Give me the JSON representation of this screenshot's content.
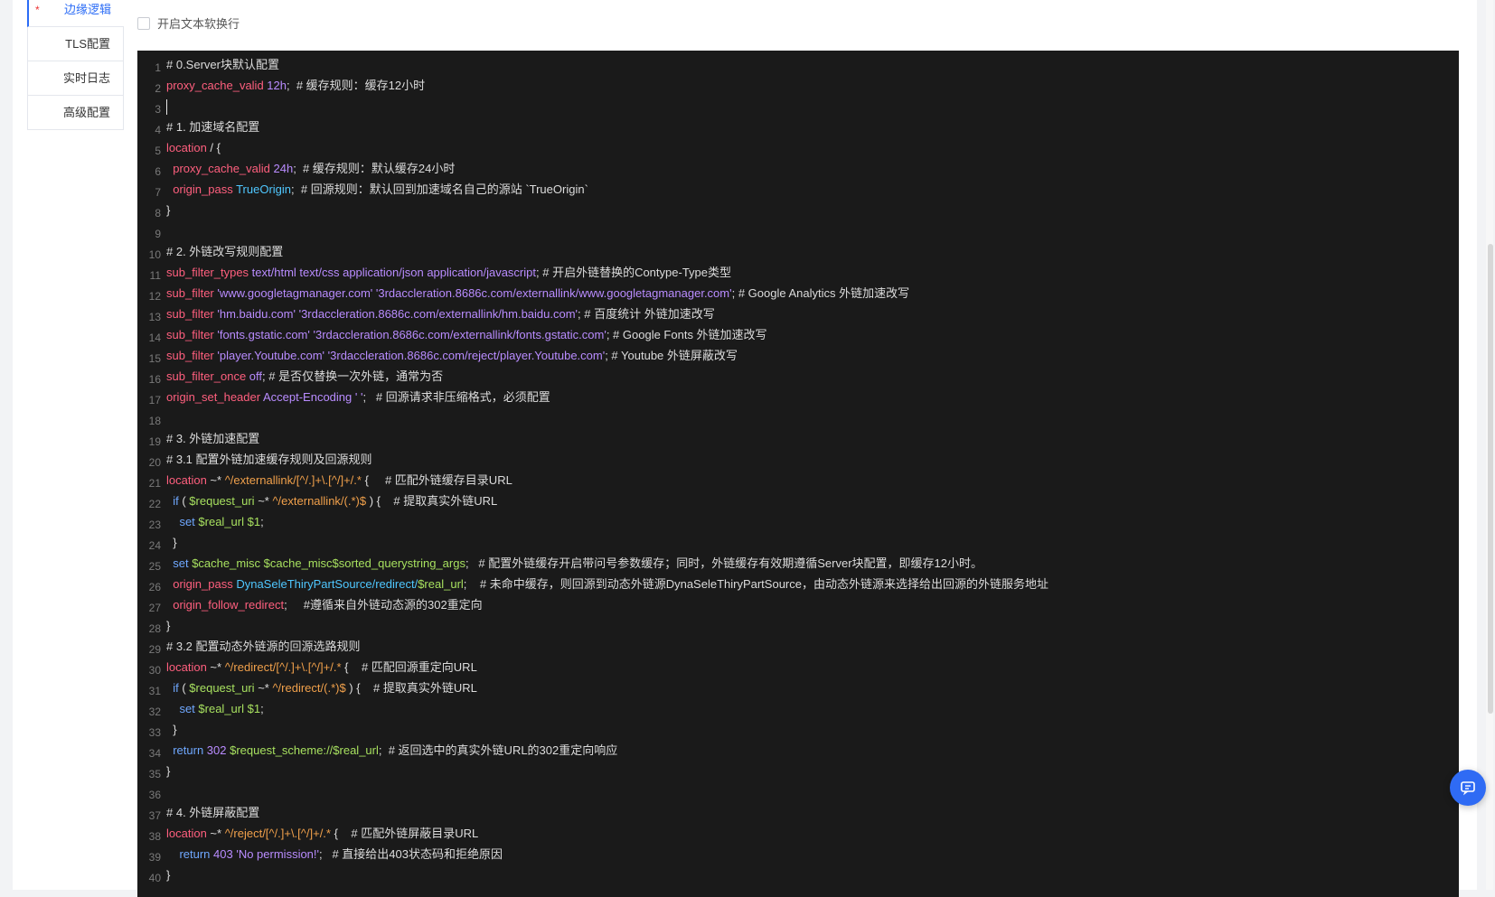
{
  "tabs": [
    {
      "label": "边缘逻辑",
      "required_mark": "*"
    },
    {
      "label": "TLS配置"
    },
    {
      "label": "实时日志"
    },
    {
      "label": "高级配置"
    }
  ],
  "soft_wrap": {
    "label": "开启文本软换行",
    "checked": false
  },
  "code_lines": [
    {
      "n": "1",
      "segs": [
        {
          "c": "c",
          "t": "# 0.Server块默认配置"
        }
      ]
    },
    {
      "n": "2",
      "segs": [
        {
          "c": "k",
          "t": "proxy_cache_valid"
        },
        {
          "c": "n",
          "t": " 12h"
        },
        {
          "c": "c",
          "t": ";  # 缓存规则：缓存12小时"
        }
      ]
    },
    {
      "n": "3",
      "segs": [],
      "caret": true
    },
    {
      "n": "4",
      "segs": [
        {
          "c": "c",
          "t": "# 1. 加速域名配置"
        }
      ]
    },
    {
      "n": "5",
      "segs": [
        {
          "c": "k",
          "t": "location"
        },
        {
          "c": "c",
          "t": " / {"
        }
      ]
    },
    {
      "n": "6",
      "segs": [
        {
          "c": "k",
          "t": "  proxy_cache_valid"
        },
        {
          "c": "n",
          "t": " 24h"
        },
        {
          "c": "c",
          "t": ";  # 缓存规则：默认缓存24小时"
        }
      ]
    },
    {
      "n": "7",
      "segs": [
        {
          "c": "k",
          "t": "  origin_pass"
        },
        {
          "c": "t",
          "t": " TrueOrigin"
        },
        {
          "c": "c",
          "t": ";  # 回源规则：默认回到加速域名自己的源站 `TrueOrigin`"
        }
      ]
    },
    {
      "n": "8",
      "segs": [
        {
          "c": "c",
          "t": "}"
        }
      ]
    },
    {
      "n": "9",
      "segs": []
    },
    {
      "n": "10",
      "segs": [
        {
          "c": "c",
          "t": "# 2. 外链改写规则配置"
        }
      ]
    },
    {
      "n": "11",
      "segs": [
        {
          "c": "k",
          "t": "sub_filter_types"
        },
        {
          "c": "v",
          "t": " text/html text/css application/json application/javascript"
        },
        {
          "c": "c",
          "t": "; # 开启外链替换的Contype-Type类型"
        }
      ]
    },
    {
      "n": "12",
      "segs": [
        {
          "c": "k",
          "t": "sub_filter"
        },
        {
          "c": "v",
          "t": " 'www.googletagmanager.com' '3rdaccleration.8686c.com/externallink/www.googletagmanager.com'"
        },
        {
          "c": "c",
          "t": "; # Google Analytics 外链加速改写"
        }
      ]
    },
    {
      "n": "13",
      "segs": [
        {
          "c": "k",
          "t": "sub_filter"
        },
        {
          "c": "v",
          "t": " 'hm.baidu.com' '3rdaccleration.8686c.com/externallink/hm.baidu.com'"
        },
        {
          "c": "c",
          "t": "; # 百度统计 外链加速改写"
        }
      ]
    },
    {
      "n": "14",
      "segs": [
        {
          "c": "k",
          "t": "sub_filter"
        },
        {
          "c": "v",
          "t": " 'fonts.gstatic.com' '3rdaccleration.8686c.com/externallink/fonts.gstatic.com'"
        },
        {
          "c": "c",
          "t": "; # Google Fonts 外链加速改写"
        }
      ]
    },
    {
      "n": "15",
      "segs": [
        {
          "c": "k",
          "t": "sub_filter"
        },
        {
          "c": "v",
          "t": " 'player.Youtube.com' '3rdaccleration.8686c.com/reject/player.Youtube.com'"
        },
        {
          "c": "c",
          "t": "; # Youtube 外链屏蔽改写"
        }
      ]
    },
    {
      "n": "16",
      "segs": [
        {
          "c": "k",
          "t": "sub_filter_once"
        },
        {
          "c": "v",
          "t": " off"
        },
        {
          "c": "c",
          "t": "; # 是否仅替换一次外链，通常为否"
        }
      ]
    },
    {
      "n": "17",
      "segs": [
        {
          "c": "k",
          "t": "origin_set_header"
        },
        {
          "c": "v",
          "t": " Accept-Encoding ' '"
        },
        {
          "c": "c",
          "t": ";   # 回源请求非压缩格式，必须配置"
        }
      ]
    },
    {
      "n": "18",
      "segs": []
    },
    {
      "n": "19",
      "segs": [
        {
          "c": "c",
          "t": "# 3. 外链加速配置"
        }
      ]
    },
    {
      "n": "20",
      "segs": [
        {
          "c": "c",
          "t": "# 3.1 配置外链加速缓存规则及回源规则"
        }
      ]
    },
    {
      "n": "21",
      "segs": [
        {
          "c": "k",
          "t": "location"
        },
        {
          "c": "c",
          "t": " ~* "
        },
        {
          "c": "s",
          "t": "^/externallink/[^/.]+\\.[^/]+/.*"
        },
        {
          "c": "c",
          "t": " {     # 匹配外链缓存目录URL"
        }
      ]
    },
    {
      "n": "22",
      "segs": [
        {
          "c": "kb",
          "t": "  if"
        },
        {
          "c": "c",
          "t": " ( "
        },
        {
          "c": "var",
          "t": "$request_uri"
        },
        {
          "c": "c",
          "t": " ~* "
        },
        {
          "c": "s",
          "t": "^/externallink/(.*)$"
        },
        {
          "c": "c",
          "t": " ) {    # 提取真实外链URL"
        }
      ]
    },
    {
      "n": "23",
      "segs": [
        {
          "c": "kb",
          "t": "    set"
        },
        {
          "c": "var",
          "t": " $real_url $1"
        },
        {
          "c": "c",
          "t": ";"
        }
      ]
    },
    {
      "n": "24",
      "segs": [
        {
          "c": "c",
          "t": "  }"
        }
      ]
    },
    {
      "n": "25",
      "segs": [
        {
          "c": "kb",
          "t": "  set"
        },
        {
          "c": "var",
          "t": " $cache_misc $cache_misc$sorted_querystring_args"
        },
        {
          "c": "c",
          "t": ";   # 配置外链缓存开启带问号参数缓存；同时，外链缓存有效期遵循Server块配置，即缓存12小时。"
        }
      ]
    },
    {
      "n": "26",
      "segs": [
        {
          "c": "k",
          "t": "  origin_pass"
        },
        {
          "c": "t",
          "t": " DynaSeleThiryPartSource/redirect/"
        },
        {
          "c": "var",
          "t": "$real_url"
        },
        {
          "c": "c",
          "t": ";    # 未命中缓存，则回源到动态外链源DynaSeleThiryPartSource，由动态外链源来选择给出回源的外链服务地址"
        }
      ]
    },
    {
      "n": "27",
      "segs": [
        {
          "c": "k",
          "t": "  origin_follow_redirect"
        },
        {
          "c": "c",
          "t": ";     #遵循来自外链动态源的302重定向"
        }
      ]
    },
    {
      "n": "28",
      "segs": [
        {
          "c": "c",
          "t": "}"
        }
      ]
    },
    {
      "n": "29",
      "segs": [
        {
          "c": "c",
          "t": "# 3.2 配置动态外链源的回源选路规则"
        }
      ]
    },
    {
      "n": "30",
      "segs": [
        {
          "c": "k",
          "t": "location"
        },
        {
          "c": "c",
          "t": " ~* "
        },
        {
          "c": "s",
          "t": "^/redirect/[^/.]+\\.[^/]+/.*"
        },
        {
          "c": "c",
          "t": " {    # 匹配回源重定向URL"
        }
      ]
    },
    {
      "n": "31",
      "segs": [
        {
          "c": "kb",
          "t": "  if"
        },
        {
          "c": "c",
          "t": " ( "
        },
        {
          "c": "var",
          "t": "$request_uri"
        },
        {
          "c": "c",
          "t": " ~* "
        },
        {
          "c": "s",
          "t": "^/redirect/(.*)$"
        },
        {
          "c": "c",
          "t": " ) {    # 提取真实外链URL"
        }
      ]
    },
    {
      "n": "32",
      "segs": [
        {
          "c": "kb",
          "t": "    set"
        },
        {
          "c": "var",
          "t": " $real_url $1"
        },
        {
          "c": "c",
          "t": ";"
        }
      ]
    },
    {
      "n": "33",
      "segs": [
        {
          "c": "c",
          "t": "  }"
        }
      ]
    },
    {
      "n": "34",
      "segs": [
        {
          "c": "kb",
          "t": "  return"
        },
        {
          "c": "n",
          "t": " 302"
        },
        {
          "c": "var",
          "t": " $request_scheme://$real_url"
        },
        {
          "c": "c",
          "t": ";  # 返回选中的真实外链URL的302重定向响应"
        }
      ]
    },
    {
      "n": "35",
      "segs": [
        {
          "c": "c",
          "t": "}"
        }
      ]
    },
    {
      "n": "36",
      "segs": []
    },
    {
      "n": "37",
      "segs": [
        {
          "c": "c",
          "t": "# 4. 外链屏蔽配置"
        }
      ]
    },
    {
      "n": "38",
      "segs": [
        {
          "c": "k",
          "t": "location"
        },
        {
          "c": "c",
          "t": " ~* "
        },
        {
          "c": "s",
          "t": "^/reject/[^/.]+\\.[^/]+/.*"
        },
        {
          "c": "c",
          "t": " {    # 匹配外链屏蔽目录URL"
        }
      ]
    },
    {
      "n": "39",
      "segs": [
        {
          "c": "kb",
          "t": "    return"
        },
        {
          "c": "n",
          "t": " 403"
        },
        {
          "c": "v",
          "t": " 'No permission!'"
        },
        {
          "c": "c",
          "t": ";   # 直接给出403状态码和拒绝原因"
        }
      ]
    },
    {
      "n": "40",
      "segs": [
        {
          "c": "c",
          "t": "}"
        }
      ]
    }
  ],
  "icons": {
    "chat": "chat-icon",
    "checkbox": "checkbox-icon"
  }
}
